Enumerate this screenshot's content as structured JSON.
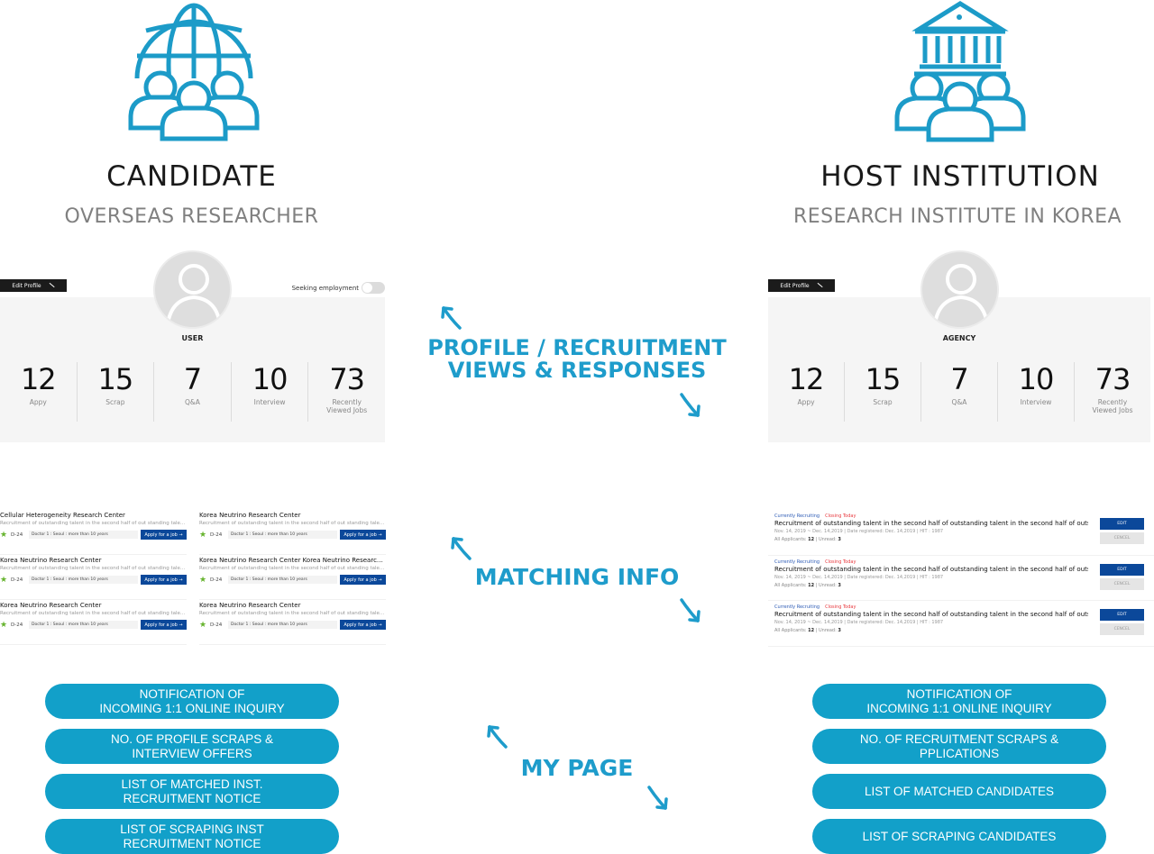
{
  "candidate": {
    "icon": "globe-people-icon",
    "title": "CANDIDATE",
    "subtitle": "OVERSEAS RESEARCHER",
    "profile": {
      "edit_label": "Edit Profile",
      "seeking_label": "Seeking employment",
      "seeking_on": false,
      "name": "USER",
      "stats": [
        {
          "value": "12",
          "label": "Appy"
        },
        {
          "value": "15",
          "label": "Scrap"
        },
        {
          "value": "7",
          "label": "Q&A"
        },
        {
          "value": "10",
          "label": "Interview"
        },
        {
          "value": "73",
          "label": "Recently Viewed Jobs"
        }
      ]
    },
    "jobs": [
      {
        "title": "Cellular Heterogeneity Research Center",
        "desc": "Recruitment of outstanding talent in the second half of out standing talent in the second···",
        "dday": "D-24",
        "meta": "Doctor 1 : Seoul : more than 10 years",
        "apply": "Apply for a job →"
      },
      {
        "title": "Korea Neutrino Research Center",
        "desc": "Recruitment of outstanding talent in the second half of out standing talent in the second···",
        "dday": "D-24",
        "meta": "Doctor 1 : Seoul : more than 10 years",
        "apply": "Apply for a job →"
      },
      {
        "title": "Korea Neutrino Research Center",
        "desc": "Recruitment of outstanding talent in the second half of out standing talent in the second···",
        "dday": "D-24",
        "meta": "Doctor 1 : Seoul : more than 10 years",
        "apply": "Apply for a job →"
      },
      {
        "title": "Korea Neutrino Research Center Korea Neutrino Research Center Kor···",
        "desc": "Recruitment of outstanding talent in the second half of out standing talent in the second···",
        "dday": "D-24",
        "meta": "Doctor 1 : Seoul : more than 10 years",
        "apply": "Apply for a job →"
      },
      {
        "title": "Korea Neutrino Research Center",
        "desc": "Recruitment of outstanding talent in the second half of out standing talent in the second···",
        "dday": "D-24",
        "meta": "Doctor 1 : Seoul : more than 10 years",
        "apply": "Apply for a job →"
      },
      {
        "title": "Korea Neutrino Research Center",
        "desc": "Recruitment of outstanding talent in the second half of out standing talent in the second···",
        "dday": "D-24",
        "meta": "Doctor 1 : Seoul : more than 10 years",
        "apply": "Apply for a job →"
      }
    ],
    "mypage": [
      "NOTIFICATION OF\nINCOMING 1:1 ONLINE INQUIRY",
      "NO. OF PROFILE SCRAPS &\nINTERVIEW OFFERS",
      "LIST OF MATCHED INST.\nRECRUITMENT NOTICE",
      "LIST OF  SCRAPING INST\nRECRUITMENT NOTICE"
    ]
  },
  "host": {
    "icon": "institution-people-icon",
    "title": "HOST  INSTITUTION",
    "subtitle": "RESEARCH INSTITUTE IN KOREA",
    "profile": {
      "edit_label": "Edit Profile",
      "name": "AGENCY",
      "stats": [
        {
          "value": "12",
          "label": "Appy"
        },
        {
          "value": "15",
          "label": "Scrap"
        },
        {
          "value": "7",
          "label": "Q&A"
        },
        {
          "value": "10",
          "label": "Interview"
        },
        {
          "value": "73",
          "label": "Recently Viewed Jobs"
        }
      ]
    },
    "recruitments": [
      {
        "status": "Currently Recruiting",
        "closing": "Closing Today",
        "title": "Recruitment of outstanding talent in the second half of outstanding talent in the second half of outstand talent in the",
        "dates": "Nov. 14, 2019 ~ Dec. 14,2019 | Date registered: Dec. 14,2019 | HIT : 1987",
        "applicants_label": "All Applicants:",
        "applicants": "12",
        "unread_label": "| Unread:",
        "unread": "3",
        "edit": "EDIT",
        "cancel": "CENCEL"
      },
      {
        "status": "Currently Recruiting",
        "closing": "Closing Today",
        "title": "Recruitment of outstanding talent in the second half of outstanding talent in the second half of outstand talent in the",
        "dates": "Nov. 14, 2019 ~ Dec. 14,2019 | Date registered: Dec. 14,2019 | HIT : 1987",
        "applicants_label": "All Applicants:",
        "applicants": "12",
        "unread_label": "| Unread:",
        "unread": "3",
        "edit": "EDIT",
        "cancel": "CENCEL"
      },
      {
        "status": "Currently Recruiting",
        "closing": "Closing Today",
        "title": "Recruitment of outstanding talent in the second half of outstanding talent in the second half of outstand talent in the",
        "dates": "Nov. 14, 2019 ~ Dec. 14,2019 | Date registered: Dec. 14,2019 | HIT : 1987",
        "applicants_label": "All Applicants:",
        "applicants": "12",
        "unread_label": "| Unread:",
        "unread": "3",
        "edit": "EDIT",
        "cancel": "CENCEL"
      }
    ],
    "mypage": [
      "NOTIFICATION OF\nINCOMING 1:1 ONLINE INQUIRY",
      "NO. OF RECRUITMENT SCRAPS &\nPPLICATIONS",
      "LIST OF MATCHED CANDIDATES",
      "LIST OF SCRAPING CANDIDATES"
    ]
  },
  "center": {
    "profile_label_line1": "PROFILE / RECRUITMENT",
    "profile_label_line2": "VIEWS  &  RESPONSES",
    "matching_label": "MATCHING INFO",
    "mypage_label": "MY PAGE"
  },
  "colors": {
    "accent": "#1e9ccb",
    "pill": "#12a0c9",
    "button_blue": "#0b489a",
    "closing_red": "#e8383d",
    "star_green": "#66b32e"
  }
}
